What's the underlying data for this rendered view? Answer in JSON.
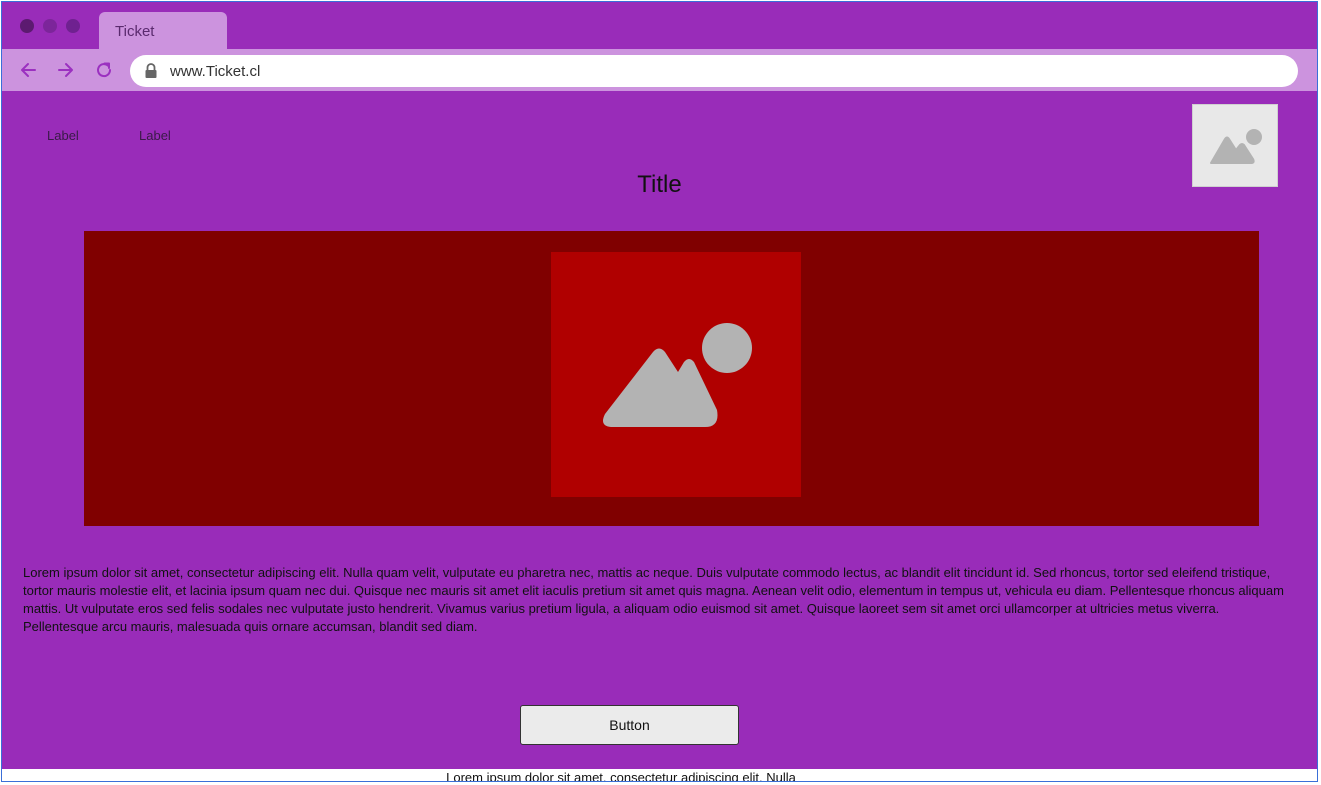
{
  "browser": {
    "tab_title": "Ticket",
    "url": "www.Ticket.cl"
  },
  "nav": {
    "labels": [
      "Label",
      "Label"
    ]
  },
  "page": {
    "title": "Title",
    "paragraph": "Lorem ipsum dolor sit amet, consectetur adipiscing elit. Nulla quam velit, vulputate eu pharetra nec, mattis ac neque. Duis vulputate commodo lectus, ac blandit elit tincidunt id. Sed rhoncus, tortor sed eleifend tristique, tortor mauris molestie elit, et lacinia ipsum quam nec dui. Quisque nec mauris sit amet elit iaculis pretium sit amet quis magna. Aenean velit odio, elementum in tempus ut, vehicula eu diam. Pellentesque rhoncus aliquam mattis. Ut vulputate eros sed felis sodales nec vulputate justo hendrerit. Vivamus varius pretium ligula, a aliquam odio euismod sit amet. Quisque laoreet sem sit amet orci ullamcorper at ultricies metus viverra. Pellentesque arcu mauris, malesuada quis ornare accumsan, blandit sed diam.",
    "button_label": "Button",
    "footer_text": "Lorem ipsum dolor sit amet, consectetur adipiscing elit. Nulla"
  },
  "colors": {
    "page_background": "#992cb9",
    "toolbar": "#cc93de",
    "hero_background": "#800000",
    "hero_image": "#b00000",
    "placeholder_icon": "#b3b3b3"
  },
  "icons": [
    "back-arrow-icon",
    "forward-arrow-icon",
    "reload-icon",
    "lock-icon",
    "image-placeholder-icon"
  ]
}
